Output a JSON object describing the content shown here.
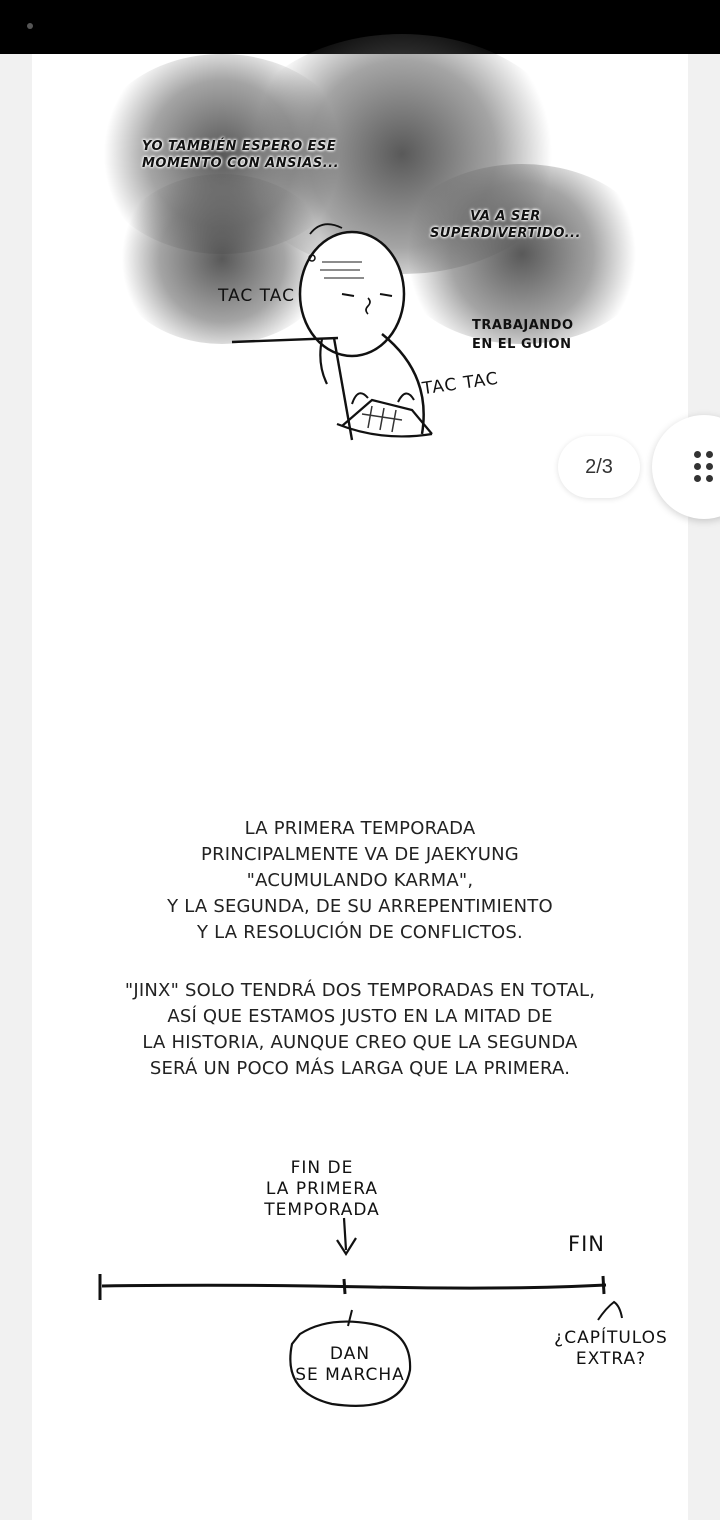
{
  "page_counter": "2/3",
  "panel": {
    "bubble_left": [
      "YO TAMBIÉN ESPERO ESE",
      "MOMENTO CON ANSIAS..."
    ],
    "bubble_right": [
      "VA A SER",
      "SUPERDIVERTIDO..."
    ],
    "sfx_left": "TAC TAC",
    "sfx_right": "TAC TAC",
    "caption": [
      "TRABAJANDO",
      "EN EL GUION"
    ]
  },
  "paragraph_1": [
    "LA PRIMERA TEMPORADA",
    "PRINCIPALMENTE VA DE JAEKYUNG",
    "\"ACUMULANDO KARMA\",",
    "Y LA SEGUNDA, DE SU ARREPENTIMIENTO",
    "Y LA RESOLUCIÓN DE CONFLICTOS."
  ],
  "paragraph_2": [
    "\"JINX\" SOLO TENDRÁ DOS TEMPORADAS EN TOTAL,",
    "ASÍ QUE ESTAMOS JUSTO EN LA MITAD DE",
    "LA HISTORIA, AUNQUE CREO QUE LA SEGUNDA",
    "SERÁ UN POCO MÁS LARGA QUE LA PRIMERA."
  ],
  "timeline": {
    "midpoint_label": [
      "FIN DE",
      "LA PRIMERA",
      "TEMPORADA"
    ],
    "end_label": "FIN",
    "bubble_label": [
      "DAN",
      "SE MARCHA"
    ],
    "extra_label": [
      "¿CAPÍTULOS",
      "EXTRA?"
    ]
  }
}
